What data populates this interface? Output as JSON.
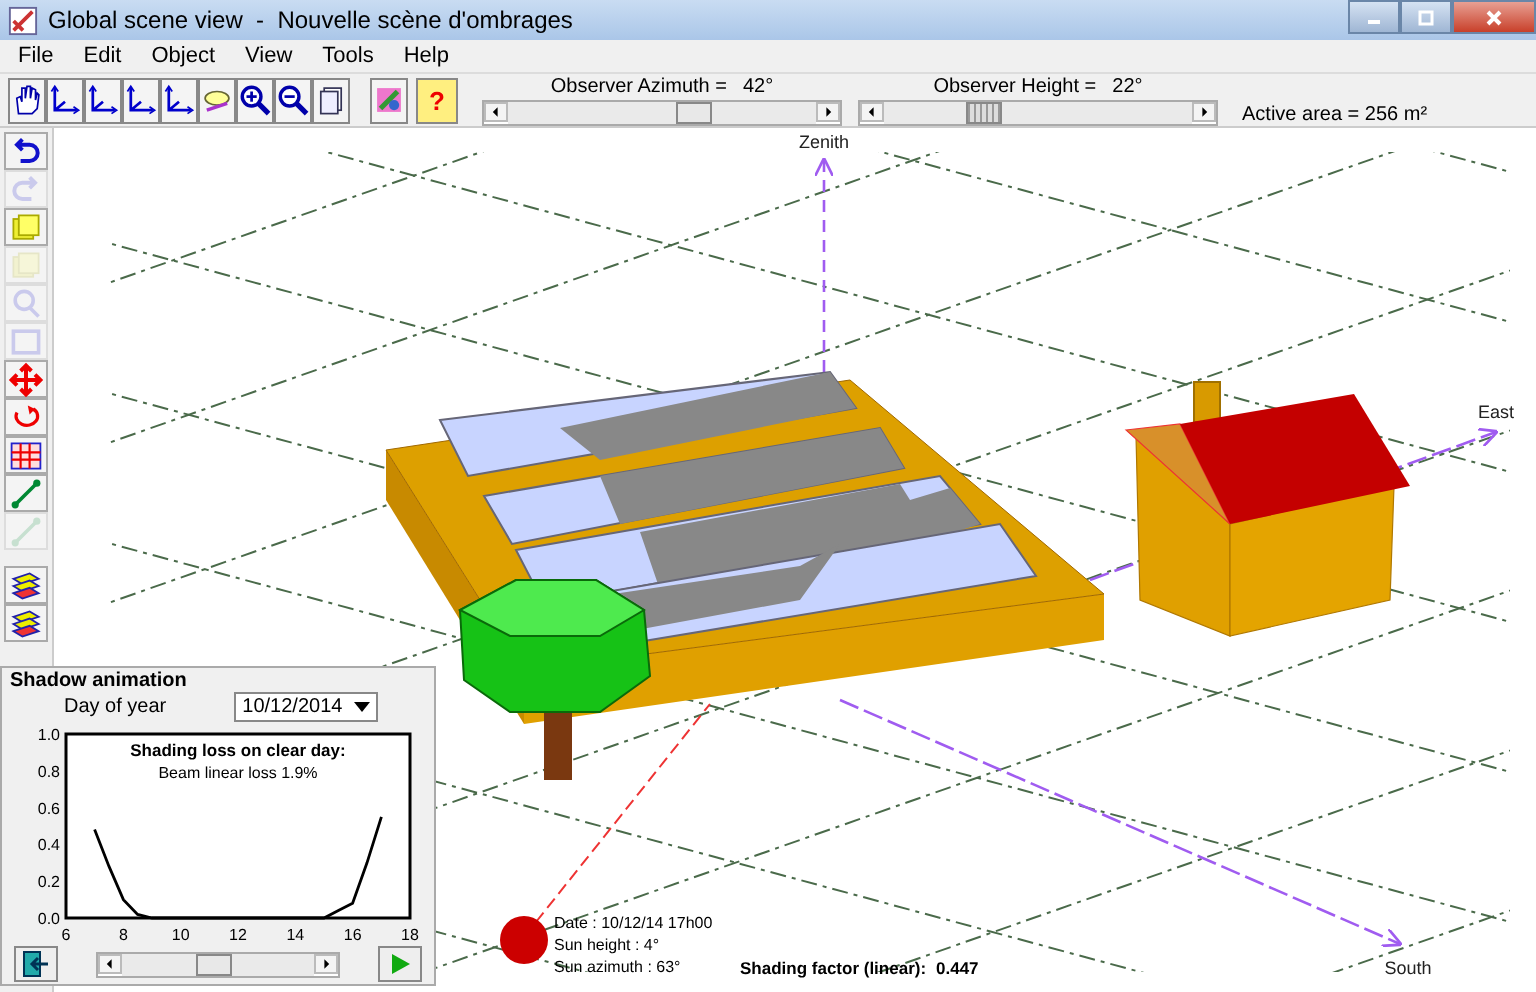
{
  "window": {
    "title": "Global scene view  -  Nouvelle scène d'ombrages"
  },
  "menu": [
    "File",
    "Edit",
    "Object",
    "View",
    "Tools",
    "Help"
  ],
  "toolbar": [
    {
      "kind": "hand"
    },
    {
      "kind": "axes"
    },
    {
      "kind": "axes"
    },
    {
      "kind": "axes"
    },
    {
      "kind": "axes"
    },
    {
      "kind": "view"
    },
    {
      "kind": "zoom-in"
    },
    {
      "kind": "zoom-out"
    },
    {
      "kind": "page"
    },
    {
      "kind": "paint"
    },
    {
      "kind": "help",
      "label": "?"
    }
  ],
  "observer": [
    {
      "label": "Observer Azimuth =",
      "value": "42°",
      "level": 0.62
    },
    {
      "label": "Observer Height =",
      "value": "22°",
      "level": 0.3
    }
  ],
  "active_area": "Active area = 256 m²",
  "side_tools": [
    {
      "kind": "undo",
      "disabled": false
    },
    {
      "kind": "redo",
      "disabled": true
    },
    {
      "kind": "copy",
      "disabled": false
    },
    {
      "kind": "copy",
      "disabled": true
    },
    {
      "kind": "search",
      "disabled": true
    },
    {
      "kind": "frame",
      "disabled": true
    },
    {
      "kind": "move",
      "disabled": false
    },
    {
      "kind": "rotate",
      "disabled": false
    },
    {
      "kind": "grid",
      "disabled": false
    },
    {
      "kind": "line",
      "disabled": false
    },
    {
      "kind": "line",
      "disabled": true
    },
    {
      "kind": "layers",
      "disabled": false
    },
    {
      "kind": "layers",
      "disabled": false
    }
  ],
  "scene": {
    "zenith": "Zenith",
    "east": "East",
    "south": "South",
    "sun_info": [
      "Date : 10/12/14 17h00",
      "Sun height : 4°",
      "Sun azimuth : 63°"
    ],
    "shading_label": "Shading factor (linear):",
    "shading_value": "0.447"
  },
  "shadow_panel": {
    "title": "Shadow animation",
    "day_label": "Day of year",
    "day_value": "10/12/2014",
    "chart_data": {
      "type": "line",
      "title": "Shading loss on clear day:",
      "annotations": [
        "Beam linear loss 1.9%"
      ],
      "xlim": [
        6,
        18
      ],
      "ylim": [
        0,
        1
      ],
      "xticks": [
        6,
        8,
        10,
        12,
        14,
        16,
        18
      ],
      "yticks": [
        {
          "value": 0,
          "label": "0.0"
        },
        {
          "value": 0.2,
          "label": "0.2"
        },
        {
          "value": 0.4,
          "label": "0.4"
        },
        {
          "value": 0.6,
          "label": "0.6"
        },
        {
          "value": 0.8,
          "label": "0.8"
        },
        {
          "value": 1,
          "label": "1.0"
        }
      ],
      "x": [
        7,
        7.5,
        8,
        8.5,
        9,
        10,
        12,
        14,
        15,
        15.5,
        16,
        16.5,
        17
      ],
      "values": [
        0.48,
        0.28,
        0.1,
        0.02,
        0,
        0,
        0,
        0,
        0,
        0.04,
        0.08,
        0.3,
        0.55
      ]
    },
    "time_slider": {
      "level": 0.45
    }
  }
}
